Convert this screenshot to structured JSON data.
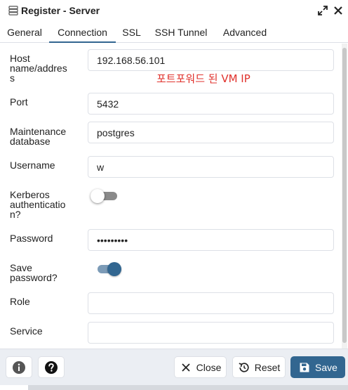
{
  "window": {
    "title": "Register - Server",
    "icons": {
      "server": "server-icon",
      "expand": "expand-icon",
      "close": "close-icon"
    }
  },
  "tabs": [
    {
      "label": "General",
      "active": false
    },
    {
      "label": "Connection",
      "active": true
    },
    {
      "label": "SSL",
      "active": false
    },
    {
      "label": "SSH Tunnel",
      "active": false
    },
    {
      "label": "Advanced",
      "active": false
    }
  ],
  "form": {
    "host": {
      "label": "Host name/address",
      "label_lines": [
        "Host",
        "name/addres",
        "s"
      ],
      "value": "192.168.56.101"
    },
    "annotation": "포트포워드 된 VM IP",
    "port": {
      "label": "Port",
      "value": "5432"
    },
    "maintenance_db": {
      "label_lines": [
        "Maintenance",
        "database"
      ],
      "value": "postgres"
    },
    "username": {
      "label": "Username",
      "value": "w"
    },
    "kerberos": {
      "label_lines": [
        "Kerberos",
        "authenticatio",
        "n?"
      ],
      "enabled": false
    },
    "password": {
      "label": "Password",
      "value": "•••••••••"
    },
    "save_password": {
      "label_lines": [
        "Save",
        "password?"
      ],
      "enabled": true
    },
    "role": {
      "label": "Role",
      "value": ""
    },
    "service": {
      "label": "Service",
      "value": ""
    }
  },
  "footer": {
    "info_icon": "info-icon",
    "help_icon": "help-icon",
    "close_label": "Close",
    "reset_label": "Reset",
    "save_label": "Save"
  },
  "colors": {
    "accent": "#326690",
    "annotation": "#e0312c",
    "footer_bg": "#ebeef3",
    "border": "#dde0e6"
  }
}
